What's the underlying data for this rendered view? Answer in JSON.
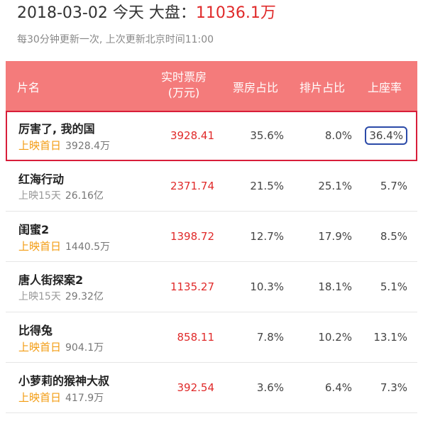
{
  "header": {
    "date": "2018-03-02",
    "today": "今天",
    "total_label": "大盘：",
    "total_value": "11036.1万",
    "update_note": "每30分钟更新一次, 上次更新北京时间11:00"
  },
  "table": {
    "headers": {
      "name": "片名",
      "realtime_line1": "实时票房",
      "realtime_line2": "(万元)",
      "box_share": "票房占比",
      "schedule_share": "排片占比",
      "seat_rate": "上座率"
    },
    "rows": [
      {
        "name": "厉害了, 我的国",
        "days": "上映首日",
        "first_day": true,
        "cumulative": "3928.4万",
        "realtime": "3928.41",
        "box_share": "35.6%",
        "schedule_share": "8.0%",
        "seat_rate": "36.4%"
      },
      {
        "name": "红海行动",
        "days": "上映15天",
        "first_day": false,
        "cumulative": "26.16亿",
        "realtime": "2371.74",
        "box_share": "21.5%",
        "schedule_share": "25.1%",
        "seat_rate": "5.7%"
      },
      {
        "name": "闺蜜2",
        "days": "上映首日",
        "first_day": true,
        "cumulative": "1440.5万",
        "realtime": "1398.72",
        "box_share": "12.7%",
        "schedule_share": "17.9%",
        "seat_rate": "8.5%"
      },
      {
        "name": "唐人街探案2",
        "days": "上映15天",
        "first_day": false,
        "cumulative": "29.32亿",
        "realtime": "1135.27",
        "box_share": "10.3%",
        "schedule_share": "18.1%",
        "seat_rate": "5.1%"
      },
      {
        "name": "比得兔",
        "days": "上映首日",
        "first_day": true,
        "cumulative": "904.1万",
        "realtime": "858.11",
        "box_share": "7.8%",
        "schedule_share": "10.2%",
        "seat_rate": "13.1%"
      },
      {
        "name": "小萝莉的猴神大叔",
        "days": "上映首日",
        "first_day": true,
        "cumulative": "417.9万",
        "realtime": "392.54",
        "box_share": "3.6%",
        "schedule_share": "6.4%",
        "seat_rate": "7.3%"
      }
    ]
  },
  "colors": {
    "header_bg": "#f47b7b",
    "accent_red": "#e02a2a",
    "first_day_orange": "#f39c12",
    "highlight_row_border": "#d81e3a",
    "highlight_cell_border": "#2b4aa8"
  }
}
